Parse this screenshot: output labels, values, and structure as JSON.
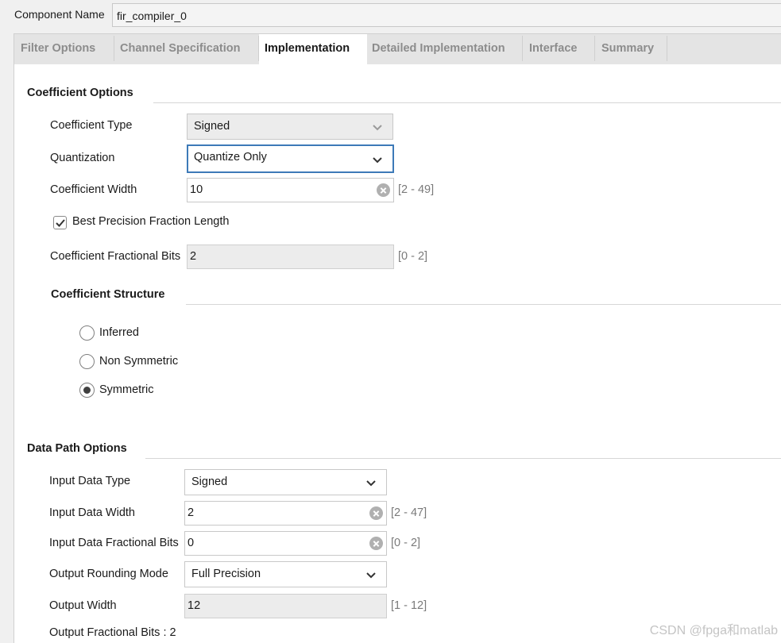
{
  "component": {
    "label": "Component Name",
    "value": "fir_compiler_0"
  },
  "tabs": [
    {
      "label": "Filter Options"
    },
    {
      "label": "Channel Specification"
    },
    {
      "label": "Implementation"
    },
    {
      "label": "Detailed Implementation"
    },
    {
      "label": "Interface"
    },
    {
      "label": "Summary"
    }
  ],
  "active_tab": "Implementation",
  "coefficient_options": {
    "title": "Coefficient Options",
    "coefficient_type": {
      "label": "Coefficient Type",
      "value": "Signed"
    },
    "quantization": {
      "label": "Quantization",
      "value": "Quantize Only"
    },
    "coefficient_width": {
      "label": "Coefficient Width",
      "value": "10",
      "range": "[2 - 49]"
    },
    "best_precision": {
      "label": "Best Precision Fraction Length",
      "checked": true
    },
    "fractional_bits": {
      "label": "Coefficient Fractional Bits",
      "value": "2",
      "range": "[0 - 2]"
    }
  },
  "coefficient_structure": {
    "title": "Coefficient Structure",
    "options": [
      {
        "label": "Inferred",
        "selected": false
      },
      {
        "label": "Non Symmetric",
        "selected": false
      },
      {
        "label": "Symmetric",
        "selected": true
      }
    ]
  },
  "data_path_options": {
    "title": "Data Path Options",
    "input_data_type": {
      "label": "Input Data Type",
      "value": "Signed"
    },
    "input_data_width": {
      "label": "Input Data Width",
      "value": "2",
      "range": "[2 - 47]"
    },
    "input_fractional_bits": {
      "label": "Input Data Fractional Bits",
      "value": "0",
      "range": "[0 - 2]"
    },
    "output_rounding": {
      "label": "Output Rounding Mode",
      "value": "Full Precision"
    },
    "output_width": {
      "label": "Output Width",
      "value": "12",
      "range": "[1 - 12]"
    },
    "output_fractional_bits": {
      "text": "Output Fractional Bits : 2"
    }
  },
  "watermark": "CSDN @fpga和matlab",
  "colors": {
    "focus_border": "#3d7ab8",
    "active_tab_bg": "#ffffff",
    "tab_bar_bg": "#e4e4e4"
  }
}
